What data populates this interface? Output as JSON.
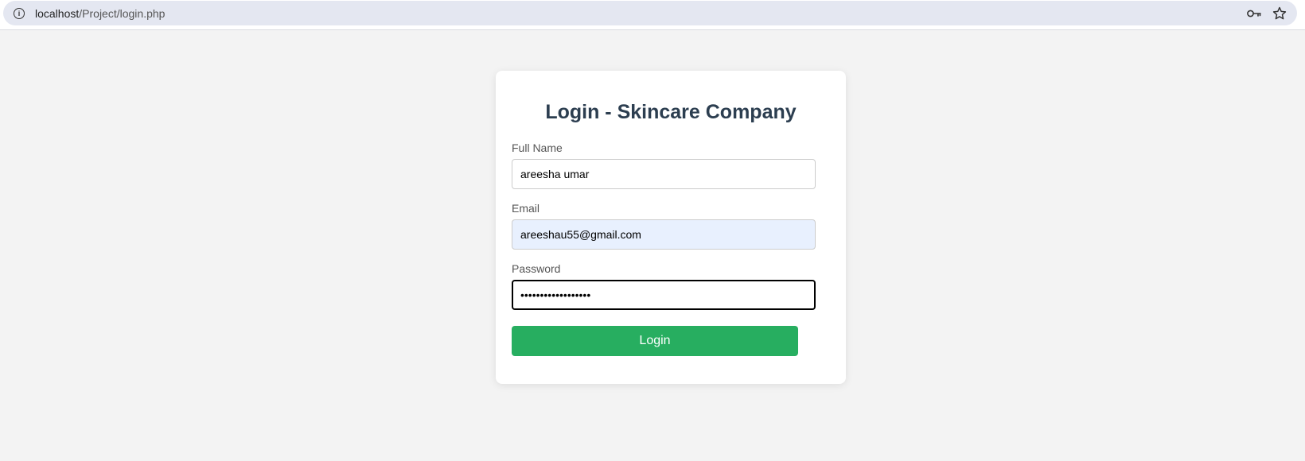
{
  "browser": {
    "url_host": "localhost",
    "url_path": "/Project/login.php",
    "icons": [
      "info-icon",
      "password-key-icon",
      "bookmark-star-icon"
    ]
  },
  "login_form": {
    "title": "Login - Skincare Company",
    "fields": {
      "full_name": {
        "label": "Full Name",
        "value": "areesha umar"
      },
      "email": {
        "label": "Email",
        "value": "areeshau55@gmail.com"
      },
      "password": {
        "label": "Password",
        "value": "••••••••••••••••••"
      }
    },
    "submit_label": "Login"
  },
  "colors": {
    "page_background": "#f3f3f3",
    "title": "#2c3e50",
    "button": "#27ae60",
    "autofill": "#e8f0fe"
  }
}
